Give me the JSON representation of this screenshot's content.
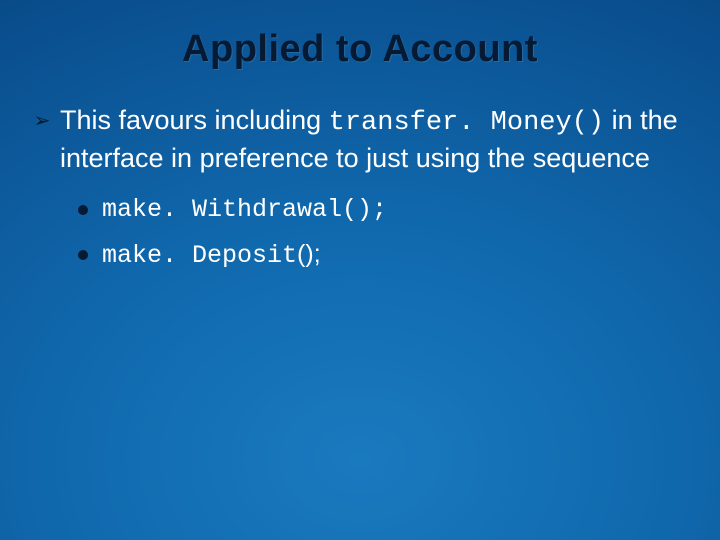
{
  "slide": {
    "title": "Applied to Account",
    "main": {
      "pre": "This favours including ",
      "code": "transfer. Money()",
      "post": " in the interface in preference to just using the sequence"
    },
    "subs": [
      {
        "code": "make. Withdrawal();"
      },
      {
        "code_a": "make. Deposit",
        "paren": "();"
      }
    ]
  }
}
